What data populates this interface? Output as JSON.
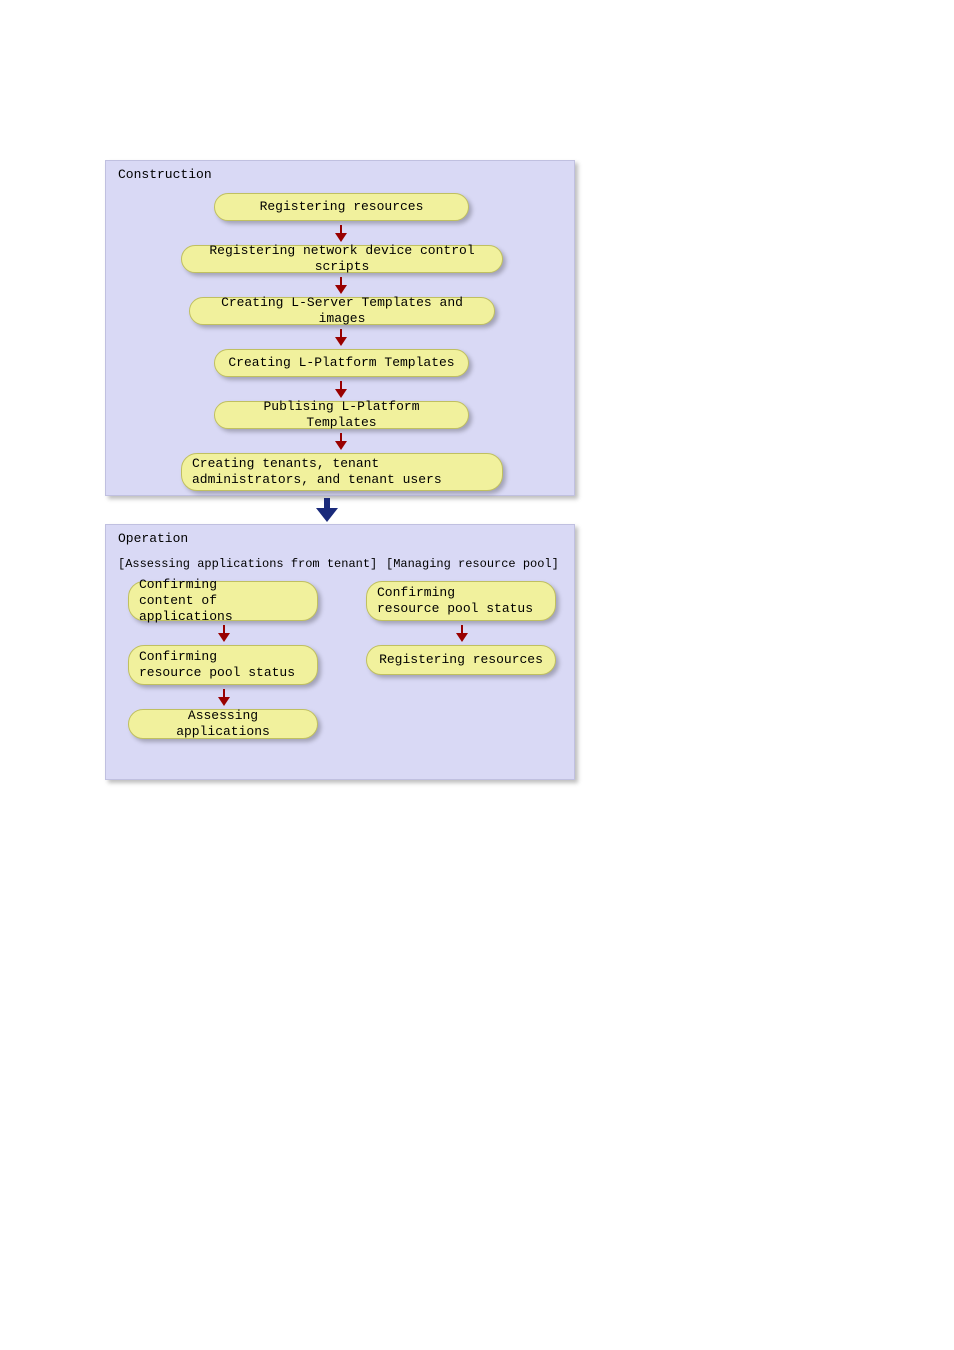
{
  "construction": {
    "title": "Construction",
    "steps": [
      "Registering resources",
      "Registering network device control scripts",
      "Creating L-Server Templates and images",
      "Creating L-Platform Templates",
      "Publising L-Platform Templates",
      "Creating tenants, tenant administrators, and tenant users"
    ]
  },
  "operation": {
    "title": "Operation",
    "left": {
      "label": "[Assessing applications from tenant]",
      "steps": [
        "Confirming\ncontent of applications",
        "Confirming\nresource pool status",
        "Assessing applications"
      ]
    },
    "right": {
      "label": "[Managing resource pool]",
      "steps": [
        "Confirming\nresource pool status",
        "Registering resources"
      ]
    }
  }
}
